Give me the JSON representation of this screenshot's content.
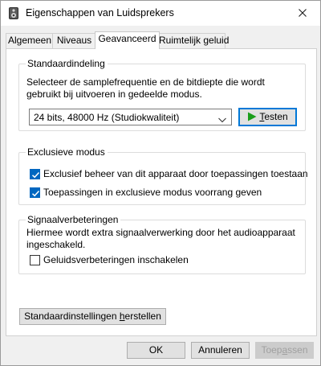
{
  "window": {
    "title": "Eigenschappen van Luidsprekers",
    "close_icon": "close-icon",
    "app_icon": "speaker-icon"
  },
  "tabs": [
    {
      "label": "Algemeen",
      "active": false
    },
    {
      "label": "Niveaus",
      "active": false
    },
    {
      "label": "Geavanceerd",
      "active": true
    },
    {
      "label": "Ruimtelijk geluid",
      "active": false
    }
  ],
  "default_format": {
    "group_title": "Standaardindeling",
    "description": "Selecteer de samplefrequentie en de bitdiepte die wordt gebruikt bij uitvoeren in gedeelde modus.",
    "selected": "24 bits, 48000 Hz (Studiokwaliteit)",
    "test_button": {
      "prefix": "",
      "accel": "T",
      "suffix": "esten",
      "icon": "play-icon",
      "icon_color": "#1b9e1b"
    }
  },
  "exclusive_mode": {
    "group_title": "Exclusieve modus",
    "options": [
      {
        "label": "Exclusief beheer van dit apparaat door toepassingen toestaan",
        "checked": true
      },
      {
        "label": "Toepassingen in exclusieve modus voorrang geven",
        "checked": true
      }
    ]
  },
  "signal_enhancements": {
    "group_title": "Signaalverbeteringen",
    "description": "Hiermee wordt extra signaalverwerking door het audioapparaat ingeschakeld.",
    "option": {
      "label": "Geluidsverbeteringen inschakelen",
      "checked": false
    }
  },
  "restore_defaults": {
    "prefix": "Standaardinstellingen ",
    "accel": "h",
    "suffix": "erstellen"
  },
  "footer": {
    "ok": "OK",
    "cancel": "Annuleren",
    "apply": {
      "prefix": "Toep",
      "accel": "a",
      "suffix": "ssen",
      "disabled": true
    }
  },
  "colors": {
    "accent": "#0067c0",
    "focus_border": "#0078d7"
  }
}
